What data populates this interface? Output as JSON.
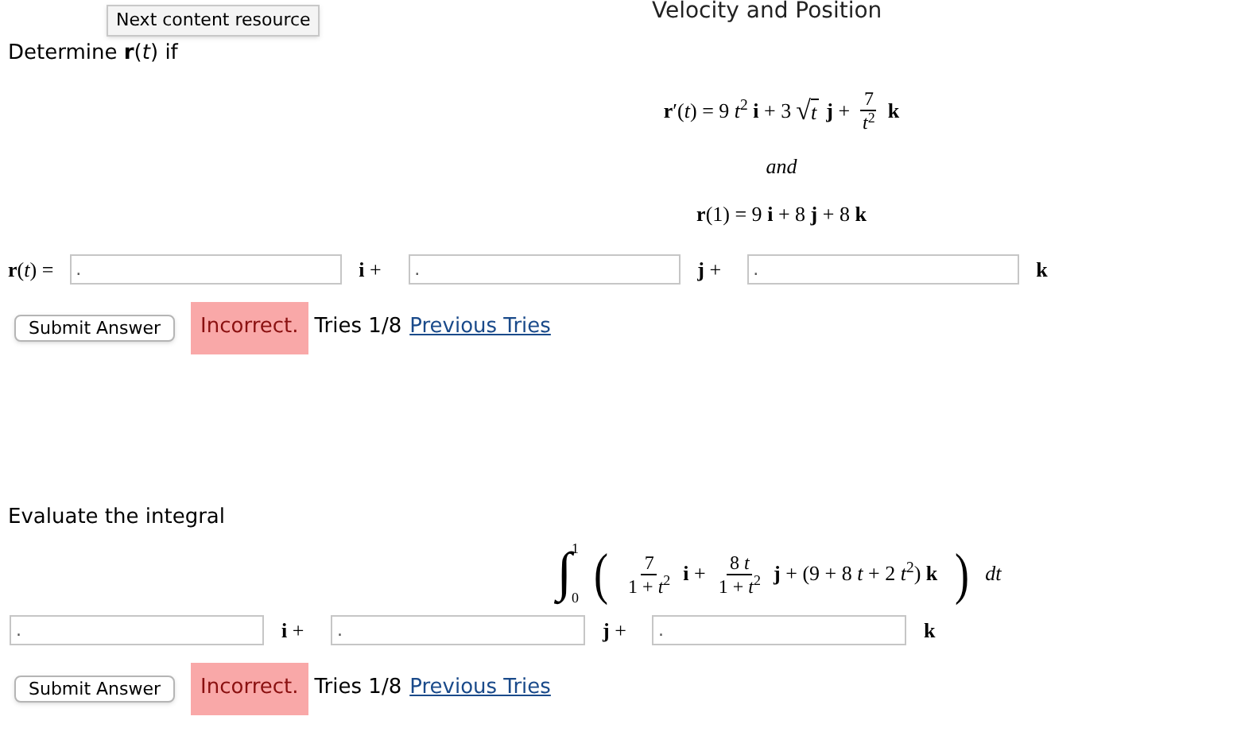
{
  "page_title": "Velocity and Position",
  "tooltip": "Next content resource",
  "problems": [
    {
      "prompt": "Determine **r**(*t*) if",
      "display": [
        [
          {
            "kind": "text",
            "text": "**r**′(*t*) = 9 *t*$^{2}$ **i** + 3"
          },
          {
            "kind": "sqrt",
            "radical": "√",
            "text": "*t*"
          },
          {
            "kind": "text",
            "text": "**j** +"
          },
          {
            "kind": "frac",
            "num": "7",
            "den": "*t*$^{2}$"
          },
          {
            "kind": "text",
            "text": "**k**"
          }
        ],
        [
          {
            "kind": "conj",
            "text": "and"
          }
        ],
        [
          {
            "kind": "text",
            "text": "**r**(1) = 9 **i** + 8 **j** + 8 **k**"
          }
        ]
      ],
      "answer": {
        "label": "**r**(*t*) =",
        "fields": [
          {
            "value": ".",
            "suffix": "**i** +"
          },
          {
            "value": ".",
            "suffix": "**j** +"
          },
          {
            "value": ".",
            "suffix": "**k**"
          }
        ]
      },
      "submit": "Submit Answer",
      "status": {
        "result": "Incorrect.",
        "correct": false,
        "tries": "Tries 1/8",
        "link": "Previous Tries"
      }
    },
    {
      "prompt": "Evaluate the integral",
      "display": [
        [
          {
            "kind": "integral",
            "symbol": "∫",
            "upper": "1",
            "lower": "0"
          },
          {
            "kind": "paren",
            "text": "("
          },
          {
            "kind": "frac",
            "num": "7",
            "den": "1 + *t*$^{2}$"
          },
          {
            "kind": "text",
            "text": "**i** +"
          },
          {
            "kind": "frac",
            "num": "8 *t*",
            "den": "1 + *t*$^{2}$"
          },
          {
            "kind": "text",
            "text": "**j** + (9 + 8 *t* + 2 *t*$^{2}$) **k**"
          },
          {
            "kind": "paren",
            "text": ")"
          },
          {
            "kind": "text",
            "text": "*dt*"
          }
        ]
      ],
      "answer": {
        "fields": [
          {
            "value": ".",
            "suffix": "**i** +"
          },
          {
            "value": ".",
            "suffix": "**j** +"
          },
          {
            "value": ".",
            "suffix": "**k**"
          }
        ]
      },
      "submit": "Submit Answer",
      "status": {
        "result": "Incorrect.",
        "correct": false,
        "tries": "Tries 1/8",
        "link": "Previous Tries"
      }
    }
  ]
}
